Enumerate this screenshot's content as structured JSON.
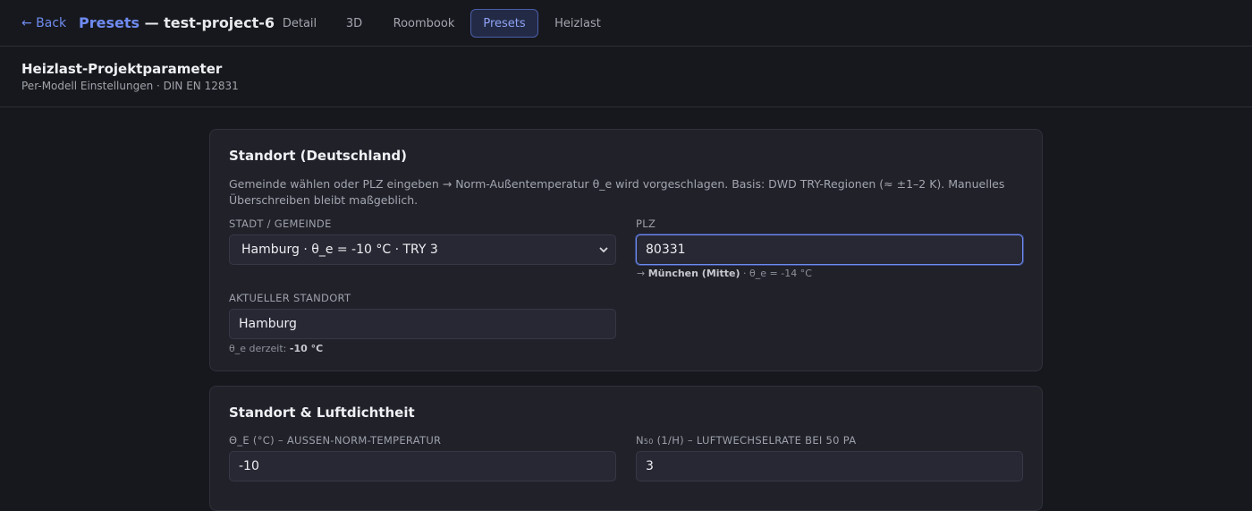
{
  "header": {
    "back_label": "← Back",
    "title_accent": "Presets",
    "title_rest": " — test-project-6",
    "tabs": [
      {
        "label": "Detail",
        "active": false
      },
      {
        "label": "3D",
        "active": false
      },
      {
        "label": "Roombook",
        "active": false
      },
      {
        "label": "Presets",
        "active": true
      },
      {
        "label": "Heizlast",
        "active": false
      }
    ]
  },
  "subheader": {
    "title": "Heizlast-Projektparameter",
    "subtitle": "Per-Modell Einstellungen · DIN EN 12831"
  },
  "location_card": {
    "title": "Standort (Deutschland)",
    "description": "Gemeinde wählen oder PLZ eingeben → Norm-Außentemperatur θ_e wird vorgeschlagen. Basis: DWD TRY-Regionen (≈ ±1–2 K). Manuelles Überschreiben bleibt maßgeblich.",
    "city_label": "Stadt / Gemeinde",
    "city_value": "Hamburg · θ_e = -10 °C · TRY 3",
    "plz_label": "PLZ",
    "plz_value": "80331",
    "plz_hint_prefix": "→ ",
    "plz_hint_city": "München (Mitte)",
    "plz_hint_suffix": " · θ_e = -14 °C",
    "current_label": "Aktueller Standort",
    "current_value": "Hamburg",
    "current_hint_prefix": "θ_e derzeit: ",
    "current_hint_value": "-10 °C"
  },
  "airtight_card": {
    "title": "Standort & Luftdichtheit",
    "temp_label": "θ_e (°C) – Aussen-Norm-Temperatur",
    "temp_value": "-10",
    "n50_label_main": "N",
    "n50_label_sub": "50",
    "n50_label_rest": " (1/H) – Luftwechselrate bei 50 Pa",
    "n50_value": "3"
  },
  "colors": {
    "accent": "#6f8bf0",
    "background": "#17181d",
    "card": "#202129"
  },
  "icons": {
    "select_arrow": "chevron-down-icon"
  }
}
